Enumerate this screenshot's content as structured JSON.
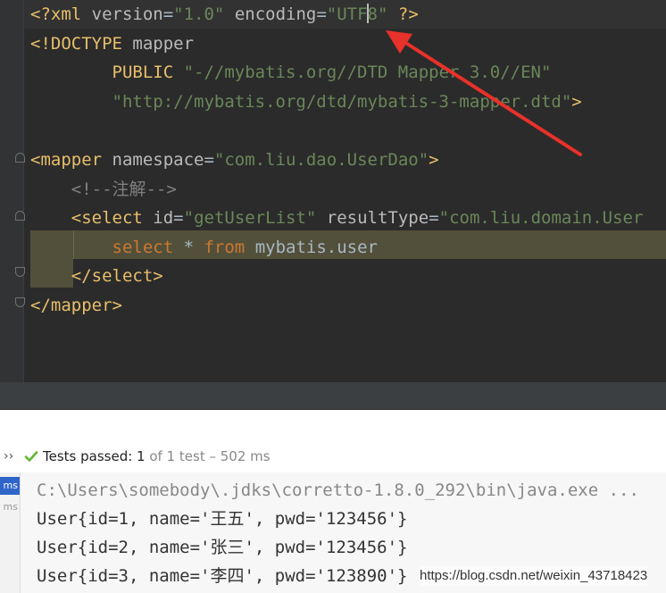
{
  "editor": {
    "lines": [
      {
        "segments": [
          {
            "t": "<?xml ",
            "c": "tag"
          },
          {
            "t": "version",
            "c": "attr"
          },
          {
            "t": "=",
            "c": "plain"
          },
          {
            "t": "\"1.0\"",
            "c": "str"
          },
          {
            "t": " encoding",
            "c": "attr"
          },
          {
            "t": "=",
            "c": "plain"
          },
          {
            "t": "\"UTF",
            "c": "str"
          },
          {
            "t": "|caret|",
            "c": "caret"
          },
          {
            "t": "8\"",
            "c": "str"
          },
          {
            "t": " ?>",
            "c": "tag"
          }
        ]
      },
      {
        "segments": [
          {
            "t": "<!DOCTYPE ",
            "c": "tag"
          },
          {
            "t": "mapper",
            "c": "attr"
          }
        ]
      },
      {
        "segments": [
          {
            "t": "        PUBLIC ",
            "c": "tag"
          },
          {
            "t": "\"-//mybatis.org//DTD Mapper 3.0//EN\"",
            "c": "str"
          }
        ]
      },
      {
        "segments": [
          {
            "t": "        \"http://mybatis.org/dtd/mybatis-3-mapper.dtd\"",
            "c": "str"
          },
          {
            "t": ">",
            "c": "tag"
          }
        ]
      },
      {
        "segments": []
      },
      {
        "segments": [
          {
            "t": "<mapper ",
            "c": "tag"
          },
          {
            "t": "namespace",
            "c": "attr"
          },
          {
            "t": "=",
            "c": "plain"
          },
          {
            "t": "\"com.liu.dao.UserDao\"",
            "c": "str"
          },
          {
            "t": ">",
            "c": "tag"
          }
        ]
      },
      {
        "segments": [
          {
            "t": "    <!--注解-->",
            "c": "cmt"
          }
        ]
      },
      {
        "segments": [
          {
            "t": "    <select ",
            "c": "tag"
          },
          {
            "t": "id",
            "c": "attr"
          },
          {
            "t": "=",
            "c": "plain"
          },
          {
            "t": "\"getUserList\"",
            "c": "str"
          },
          {
            "t": " resultType",
            "c": "attr"
          },
          {
            "t": "=",
            "c": "plain"
          },
          {
            "t": "\"com.liu.domain.User",
            "c": "str"
          }
        ]
      },
      {
        "segments": [
          {
            "t": "        select ",
            "c": "kw"
          },
          {
            "t": "* ",
            "c": "plain"
          },
          {
            "t": "from ",
            "c": "kw"
          },
          {
            "t": "mybatis.user",
            "c": "plain"
          }
        ]
      },
      {
        "segments": [
          {
            "t": "    </select>",
            "c": "tag"
          }
        ]
      },
      {
        "segments": [
          {
            "t": "</mapper>",
            "c": "tag"
          }
        ]
      }
    ]
  },
  "run_panel": {
    "more_label": "››",
    "status_label": "Tests passed: ",
    "status_count": "1",
    "status_detail": " of 1 test – 502 ms",
    "left_items": [
      "ms",
      "ms"
    ],
    "console_lines": [
      "C:\\Users\\somebody\\.jdks\\corretto-1.8.0_292\\bin\\java.exe ...",
      "User{id=1, name='王五', pwd='123456'}",
      "User{id=2, name='张三', pwd='123456'}",
      "User{id=3, name='李四', pwd='123890'}"
    ]
  },
  "watermark": "https://blog.csdn.net/weixin_43718423",
  "colors": {
    "editor_bg": "#2b2b2b",
    "tag": "#e8bf6a",
    "string": "#6a8759",
    "keyword": "#cc7832",
    "comment": "#808080",
    "pass_green": "#5fb832",
    "arrow_red": "#e8312a"
  },
  "icons": {
    "pass": "check-icon",
    "fold": "fold-marker-icon",
    "annotation": "red-arrow-icon"
  }
}
